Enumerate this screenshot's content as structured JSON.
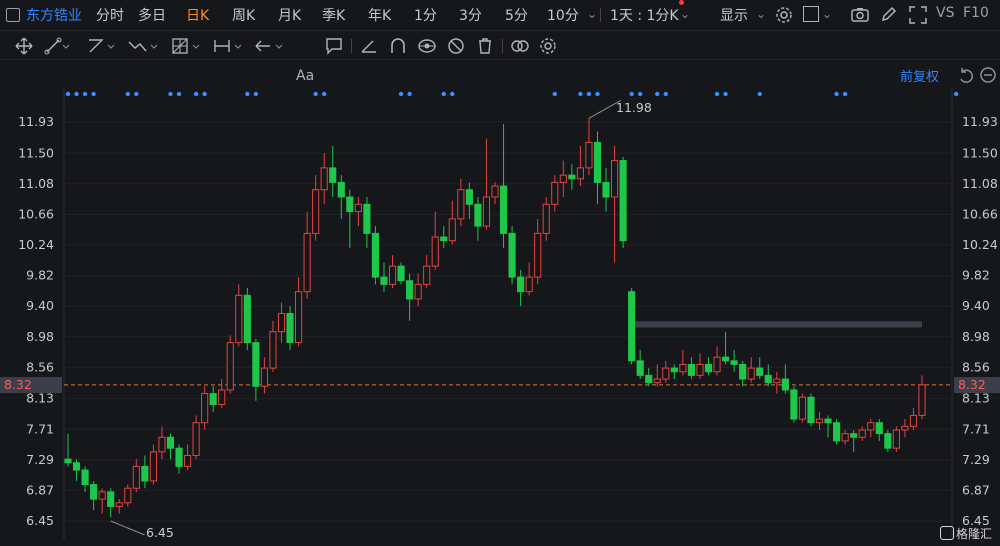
{
  "top": {
    "stock_name": "东方锆业",
    "tabs": [
      "分时",
      "多日",
      "日K",
      "周K",
      "月K",
      "季K",
      "年K",
      "1分",
      "3分",
      "5分",
      "10分"
    ],
    "active_tab": "日K",
    "period_select": "1天 : 1分K",
    "display_label": "显示",
    "vs_label": "VS",
    "f10_label": "F10"
  },
  "toolbar": {
    "icons": [
      "move-icon",
      "line-icon",
      "polyline-icon",
      "wave-icon",
      "grid-icon",
      "range-icon",
      "arrow-icon",
      "text-icon",
      "comment-icon",
      "angle-icon",
      "magnet-icon",
      "eye-icon",
      "hide-icon",
      "delete-icon",
      "link-icon",
      "settings-icon"
    ]
  },
  "chart": {
    "adjust_label": "前复权",
    "current_price_label": "8.32",
    "high_label": "11.98",
    "low_label": "6.45"
  },
  "chart_data": {
    "type": "candlestick",
    "y_ticks": [
      "11.93",
      "11.50",
      "11.08",
      "10.66",
      "10.24",
      "9.82",
      "9.40",
      "8.98",
      "8.56",
      "8.13",
      "7.71",
      "7.29",
      "6.87",
      "6.45"
    ],
    "current_price": 8.32,
    "high": 11.98,
    "low": 6.45,
    "up_color": "#e3433f",
    "down_color": "#1ec74a",
    "candles": [
      [
        7.3,
        7.25,
        7.65,
        7.2
      ],
      [
        7.25,
        7.15,
        7.3,
        7.0
      ],
      [
        7.15,
        6.95,
        7.2,
        6.85
      ],
      [
        6.95,
        6.75,
        7.0,
        6.6
      ],
      [
        6.75,
        6.85,
        6.9,
        6.55
      ],
      [
        6.85,
        6.65,
        6.9,
        6.5
      ],
      [
        6.65,
        6.7,
        6.75,
        6.55
      ],
      [
        6.7,
        6.9,
        6.95,
        6.65
      ],
      [
        6.9,
        7.2,
        7.3,
        6.85
      ],
      [
        7.2,
        7.0,
        7.35,
        6.9
      ],
      [
        7.0,
        7.4,
        7.5,
        6.95
      ],
      [
        7.4,
        7.6,
        7.75,
        7.3
      ],
      [
        7.6,
        7.45,
        7.65,
        7.3
      ],
      [
        7.45,
        7.2,
        7.5,
        7.1
      ],
      [
        7.2,
        7.35,
        7.5,
        7.15
      ],
      [
        7.35,
        7.8,
        7.9,
        7.3
      ],
      [
        7.8,
        8.2,
        8.3,
        7.7
      ],
      [
        8.2,
        8.05,
        8.3,
        7.95
      ],
      [
        8.05,
        8.25,
        8.4,
        8.0
      ],
      [
        8.25,
        8.9,
        9.0,
        8.2
      ],
      [
        8.9,
        9.55,
        9.7,
        8.85
      ],
      [
        9.55,
        8.9,
        9.65,
        8.8
      ],
      [
        8.9,
        8.3,
        8.95,
        8.1
      ],
      [
        8.3,
        8.55,
        8.7,
        8.2
      ],
      [
        8.55,
        9.05,
        9.2,
        8.5
      ],
      [
        9.05,
        9.3,
        9.45,
        8.9
      ],
      [
        9.3,
        8.9,
        9.4,
        8.8
      ],
      [
        8.9,
        9.6,
        9.8,
        8.85
      ],
      [
        9.6,
        10.4,
        10.7,
        9.5
      ],
      [
        10.4,
        11.0,
        11.2,
        10.3
      ],
      [
        11.0,
        11.3,
        11.5,
        10.8
      ],
      [
        11.3,
        11.1,
        11.6,
        10.9
      ],
      [
        11.1,
        10.9,
        11.2,
        10.6
      ],
      [
        10.9,
        10.7,
        11.0,
        10.2
      ],
      [
        10.7,
        10.8,
        10.9,
        10.5
      ],
      [
        10.8,
        10.4,
        10.9,
        10.2
      ],
      [
        10.4,
        9.8,
        10.5,
        9.7
      ],
      [
        9.8,
        9.7,
        10.0,
        9.6
      ],
      [
        9.7,
        9.95,
        10.1,
        9.65
      ],
      [
        9.95,
        9.75,
        10.0,
        9.7
      ],
      [
        9.75,
        9.5,
        9.85,
        9.2
      ],
      [
        9.5,
        9.7,
        9.85,
        9.4
      ],
      [
        9.7,
        9.95,
        10.1,
        9.65
      ],
      [
        9.95,
        10.35,
        10.7,
        9.9
      ],
      [
        10.35,
        10.3,
        10.5,
        10.2
      ],
      [
        10.3,
        10.6,
        10.85,
        10.25
      ],
      [
        10.6,
        11.0,
        11.15,
        10.5
      ],
      [
        11.0,
        10.8,
        11.1,
        10.6
      ],
      [
        10.8,
        10.5,
        10.9,
        10.3
      ],
      [
        10.5,
        10.9,
        11.7,
        10.45
      ],
      [
        10.9,
        11.05,
        11.1,
        10.8
      ],
      [
        11.05,
        10.4,
        11.9,
        10.2
      ],
      [
        10.4,
        9.8,
        10.5,
        9.7
      ],
      [
        9.8,
        9.6,
        9.9,
        9.4
      ],
      [
        9.6,
        9.8,
        10.0,
        9.55
      ],
      [
        9.8,
        10.4,
        10.6,
        9.7
      ],
      [
        10.4,
        10.8,
        10.9,
        10.3
      ],
      [
        10.8,
        11.1,
        11.2,
        10.7
      ],
      [
        11.1,
        11.2,
        11.4,
        10.9
      ],
      [
        11.2,
        11.15,
        11.35,
        11.0
      ],
      [
        11.15,
        11.3,
        11.6,
        11.05
      ],
      [
        11.3,
        11.65,
        11.98,
        11.2
      ],
      [
        11.65,
        11.1,
        11.8,
        10.8
      ],
      [
        11.1,
        10.9,
        11.3,
        10.7
      ],
      [
        10.9,
        11.4,
        11.6,
        10.0
      ],
      [
        11.4,
        10.3,
        11.45,
        10.2
      ],
      [
        9.6,
        8.65,
        9.65,
        8.6
      ],
      [
        8.65,
        8.45,
        8.8,
        8.4
      ],
      [
        8.45,
        8.35,
        8.55,
        8.3
      ],
      [
        8.35,
        8.4,
        8.6,
        8.3
      ],
      [
        8.4,
        8.55,
        8.65,
        8.35
      ],
      [
        8.55,
        8.5,
        8.6,
        8.4
      ],
      [
        8.5,
        8.6,
        8.8,
        8.45
      ],
      [
        8.6,
        8.45,
        8.7,
        8.4
      ],
      [
        8.45,
        8.6,
        8.75,
        8.4
      ],
      [
        8.6,
        8.5,
        8.7,
        8.45
      ],
      [
        8.5,
        8.7,
        8.85,
        8.45
      ],
      [
        8.7,
        8.65,
        9.05,
        8.6
      ],
      [
        8.65,
        8.6,
        8.8,
        8.5
      ],
      [
        8.6,
        8.4,
        8.65,
        8.3
      ],
      [
        8.4,
        8.55,
        8.7,
        8.35
      ],
      [
        8.55,
        8.45,
        8.7,
        8.4
      ],
      [
        8.45,
        8.35,
        8.6,
        8.3
      ],
      [
        8.35,
        8.4,
        8.5,
        8.2
      ],
      [
        8.4,
        8.25,
        8.6,
        8.2
      ],
      [
        8.25,
        7.85,
        8.3,
        7.8
      ],
      [
        7.85,
        8.15,
        8.2,
        7.8
      ],
      [
        8.15,
        7.8,
        8.2,
        7.75
      ],
      [
        7.8,
        7.85,
        7.95,
        7.7
      ],
      [
        7.85,
        7.8,
        7.9,
        7.6
      ],
      [
        7.8,
        7.55,
        7.85,
        7.5
      ],
      [
        7.55,
        7.65,
        7.7,
        7.5
      ],
      [
        7.65,
        7.6,
        7.7,
        7.4
      ],
      [
        7.6,
        7.7,
        7.75,
        7.55
      ],
      [
        7.7,
        7.8,
        7.85,
        7.6
      ],
      [
        7.8,
        7.65,
        7.85,
        7.55
      ],
      [
        7.65,
        7.45,
        7.7,
        7.4
      ],
      [
        7.45,
        7.7,
        7.75,
        7.4
      ],
      [
        7.7,
        7.75,
        7.85,
        7.6
      ],
      [
        7.75,
        7.9,
        8.0,
        7.7
      ],
      [
        7.9,
        8.32,
        8.45,
        7.85
      ]
    ],
    "fill_line": {
      "from_index": 66,
      "price": 9.15,
      "color": "#3c424b"
    },
    "markers_indices": [
      0,
      1,
      2,
      3,
      7,
      8,
      12,
      13,
      15,
      16,
      21,
      22,
      29,
      30,
      39,
      40,
      44,
      45,
      57,
      60,
      61,
      62,
      66,
      67,
      69,
      70,
      76,
      77,
      81,
      90,
      91,
      104
    ]
  },
  "watermark": "格隆汇"
}
